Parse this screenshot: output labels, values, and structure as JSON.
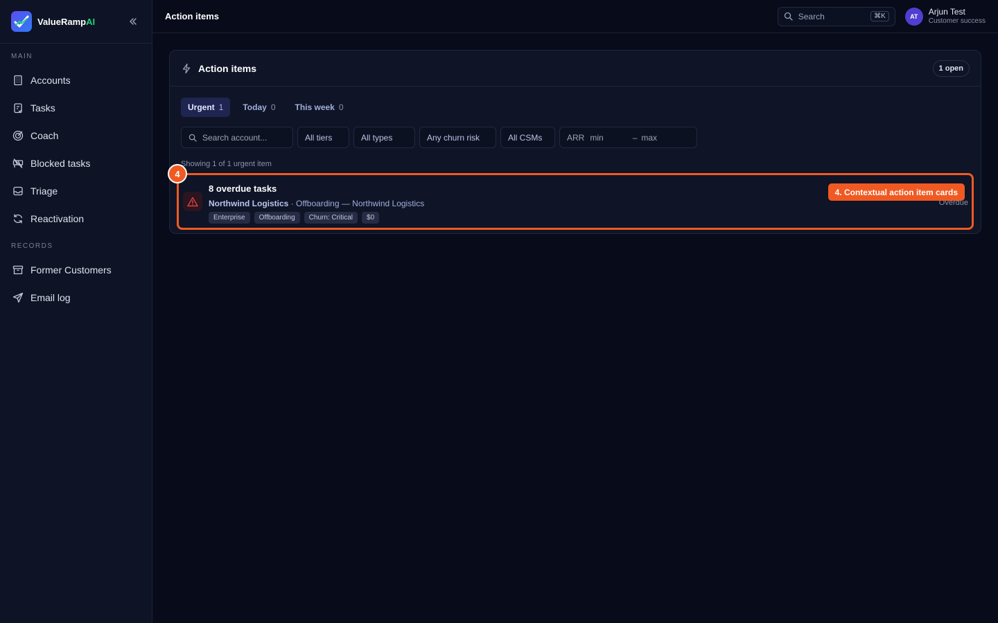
{
  "brand": {
    "name": "ValueRamp",
    "suffix": "AI"
  },
  "sidebar": {
    "sections": [
      {
        "label": "MAIN"
      },
      {
        "label": "RECORDS"
      }
    ],
    "main_items": [
      {
        "label": "Accounts",
        "icon": "building-icon"
      },
      {
        "label": "Tasks",
        "icon": "clipboard-icon"
      },
      {
        "label": "Coach",
        "icon": "target-icon"
      },
      {
        "label": "Blocked tasks",
        "icon": "blocked-icon"
      },
      {
        "label": "Triage",
        "icon": "inbox-icon"
      },
      {
        "label": "Reactivation",
        "icon": "refresh-icon"
      }
    ],
    "record_items": [
      {
        "label": "Former Customers",
        "icon": "archive-icon"
      },
      {
        "label": "Email log",
        "icon": "send-icon"
      }
    ]
  },
  "header": {
    "title": "Action items",
    "search_placeholder": "Search",
    "search_shortcut": "⌘K",
    "user": {
      "initials": "AT",
      "name": "Arjun Test",
      "role": "Customer success"
    }
  },
  "panel": {
    "title": "Action items",
    "open_badge": "1 open",
    "tabs": [
      {
        "label": "Urgent",
        "count": "1",
        "active": true
      },
      {
        "label": "Today",
        "count": "0",
        "active": false
      },
      {
        "label": "This week",
        "count": "0",
        "active": false
      }
    ],
    "filters": {
      "search_placeholder": "Search account...",
      "tiers": "All tiers",
      "types": "All types",
      "churn": "Any churn risk",
      "csms": "All CSMs",
      "arr_label": "ARR",
      "arr_min": "min",
      "arr_dash": "–",
      "arr_max": "max"
    },
    "showing": "Showing 1 of 1 urgent item",
    "card": {
      "title": "8 overdue tasks",
      "account": "Northwind Logistics",
      "separator": " · ",
      "detail": "Offboarding — Northwind Logistics",
      "chips": [
        "Enterprise",
        "Offboarding",
        "Churn: Critical",
        "$0"
      ],
      "status": "Overdue"
    }
  },
  "annotation": {
    "step": "4",
    "callout": "4. Contextual action item cards"
  },
  "colors": {
    "accent": "#f05a22",
    "active_tab_bg": "#1e2550",
    "brand_ai": "#22d37a",
    "warning": "#e0413a"
  }
}
